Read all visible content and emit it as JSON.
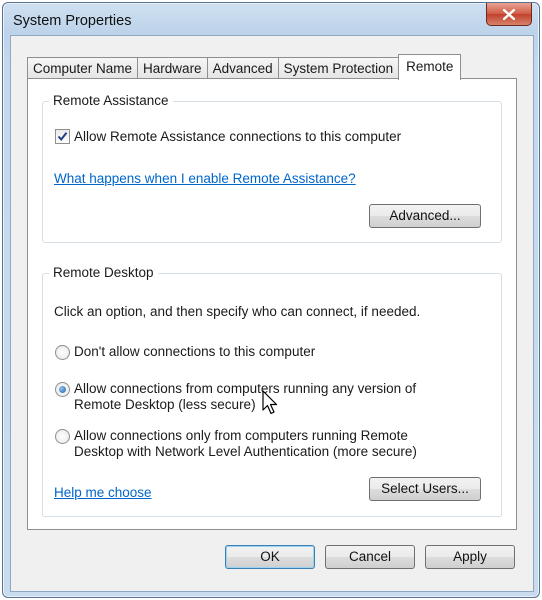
{
  "window": {
    "title": "System Properties",
    "close_icon": "close-icon"
  },
  "tabs": [
    {
      "label": "Computer Name",
      "active": false
    },
    {
      "label": "Hardware",
      "active": false
    },
    {
      "label": "Advanced",
      "active": false
    },
    {
      "label": "System Protection",
      "active": false
    },
    {
      "label": "Remote",
      "active": true
    }
  ],
  "remote_assistance": {
    "group_label": "Remote Assistance",
    "allow_checkbox_label": "Allow Remote Assistance connections to this computer",
    "allow_checked": true,
    "help_link": "What happens when I enable Remote Assistance?",
    "advanced_button": "Advanced..."
  },
  "remote_desktop": {
    "group_label": "Remote Desktop",
    "instruction": "Click an option, and then specify who can connect, if needed.",
    "options": [
      {
        "line1": "Don't allow connections to this computer",
        "line2": "",
        "selected": false
      },
      {
        "line1": "Allow connections from computers running any version of",
        "line2": "Remote Desktop (less secure)",
        "selected": true
      },
      {
        "line1": "Allow connections only from computers running Remote",
        "line2": "Desktop with Network Level Authentication (more secure)",
        "selected": false
      }
    ],
    "help_link": "Help me choose",
    "select_users_button": "Select Users..."
  },
  "footer": {
    "ok": "OK",
    "cancel": "Cancel",
    "apply": "Apply"
  },
  "colors": {
    "link": "#0066cc",
    "close_button": "#c9432c",
    "radio_selected": "#1c5fa8"
  }
}
